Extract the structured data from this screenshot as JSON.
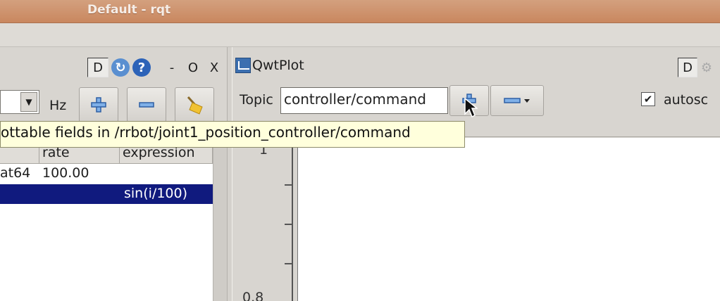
{
  "window": {
    "title": "Default - rqt"
  },
  "left_panel": {
    "dock_buttons": {
      "dock": "D",
      "minimize": "-",
      "restore": "O",
      "close": "X"
    },
    "rate_unit": "Hz",
    "table": {
      "headers": [
        "rate",
        "expression"
      ],
      "rows": [
        {
          "type": "at64",
          "rate": "100.00",
          "expression": ""
        },
        {
          "type": "",
          "rate": "",
          "expression": "sin(i/100)",
          "selected": true
        }
      ]
    }
  },
  "tooltip": {
    "text": "ottable fields in /rrbot/joint1_position_controller/command"
  },
  "plot_panel": {
    "title": "QwtPlot",
    "dock_button": "D",
    "topic_label": "Topic",
    "topic_value": "controller/command",
    "autoscroll_label": "autosc",
    "autoscroll_checked": true,
    "y_tick_labels": [
      "1",
      "0.8"
    ]
  },
  "colors": {
    "titlebar": "#c9875f",
    "selection": "#101a7e",
    "tooltip_bg": "#ffffdc"
  }
}
